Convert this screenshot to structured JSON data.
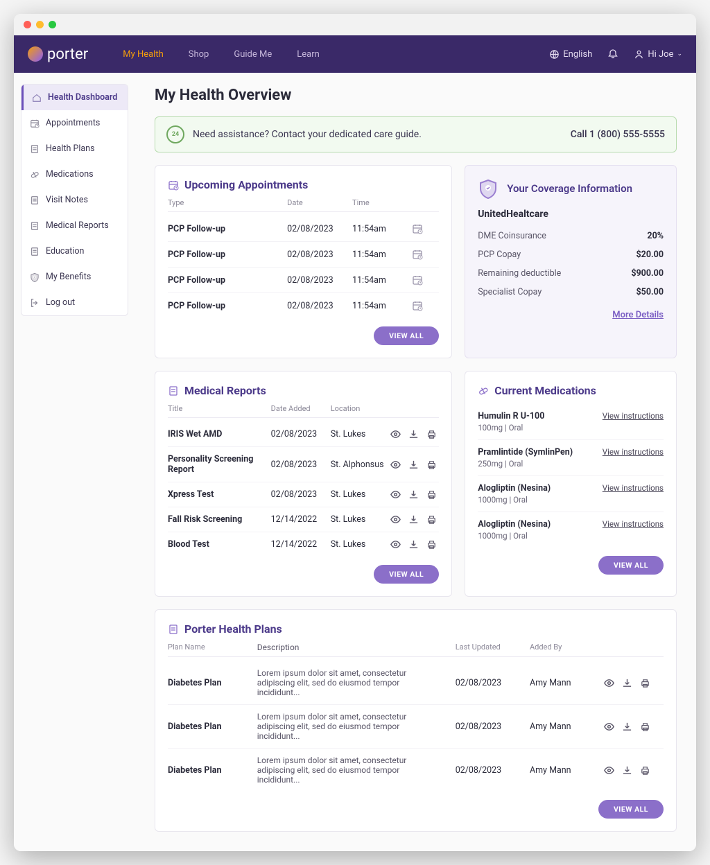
{
  "brand": "porter",
  "nav": {
    "items": [
      "My Health",
      "Shop",
      "Guide Me",
      "Learn"
    ],
    "active": 0
  },
  "topbar": {
    "lang": "English",
    "user": "Hi Joe"
  },
  "sidebar": {
    "items": [
      {
        "label": "Health Dashboard",
        "active": true
      },
      {
        "label": "Appointments"
      },
      {
        "label": "Health Plans"
      },
      {
        "label": "Medications"
      },
      {
        "label": "Visit Notes"
      },
      {
        "label": "Medical Reports"
      },
      {
        "label": "Education"
      },
      {
        "label": "My Benefits"
      },
      {
        "label": "Log out"
      }
    ]
  },
  "page_title": "My Health Overview",
  "banner": {
    "text": "Need assistance? Contact your dedicated care guide.",
    "call": "Call 1 (800) 555-5555"
  },
  "appointments": {
    "title": "Upcoming Appointments",
    "headers": {
      "type": "Type",
      "date": "Date",
      "time": "Time"
    },
    "rows": [
      {
        "type": "PCP Follow-up",
        "date": "02/08/2023",
        "time": "11:54am"
      },
      {
        "type": "PCP Follow-up",
        "date": "02/08/2023",
        "time": "11:54am"
      },
      {
        "type": "PCP Follow-up",
        "date": "02/08/2023",
        "time": "11:54am"
      },
      {
        "type": "PCP Follow-up",
        "date": "02/08/2023",
        "time": "11:54am"
      }
    ],
    "view_all": "VIEW ALL"
  },
  "coverage": {
    "title": "Your Coverage Information",
    "provider": "UnitedHealtcare",
    "rows": [
      {
        "label": "DME Coinsurance",
        "value": "20%"
      },
      {
        "label": "PCP Copay",
        "value": "$20.00"
      },
      {
        "label": "Remaining deductible",
        "value": "$900.00"
      },
      {
        "label": "Specialist Copay",
        "value": "$50.00"
      }
    ],
    "more": "More Details"
  },
  "reports": {
    "title": "Medical Reports",
    "headers": {
      "title": "Title",
      "date": "Date Added",
      "loc": "Location"
    },
    "rows": [
      {
        "title": "IRIS Wet AMD",
        "date": "02/08/2023",
        "loc": "St. Lukes"
      },
      {
        "title": "Personality Screening Report",
        "date": "02/08/2023",
        "loc": "St. Alphonsus"
      },
      {
        "title": "Xpress Test",
        "date": "02/08/2023",
        "loc": "St. Lukes"
      },
      {
        "title": "Fall Risk Screening",
        "date": "12/14/2022",
        "loc": "St. Lukes"
      },
      {
        "title": "Blood Test",
        "date": "12/14/2022",
        "loc": "St. Lukes"
      }
    ],
    "view_all": "VIEW ALL"
  },
  "medications": {
    "title": "Current Medications",
    "instructions_label": "View instructions",
    "rows": [
      {
        "name": "Humulin R U-100",
        "dose": "100mg | Oral"
      },
      {
        "name": "Pramlintide (SymlinPen)",
        "dose": "250mg | Oral"
      },
      {
        "name": "Alogliptin (Nesina)",
        "dose": "1000mg | Oral"
      },
      {
        "name": "Alogliptin (Nesina)",
        "dose": "1000mg | Oral"
      }
    ],
    "view_all": "VIEW ALL"
  },
  "plans": {
    "title": "Porter Health Plans",
    "headers": {
      "name": "Plan Name",
      "desc": "Description",
      "updated": "Last Updated",
      "by": "Added By"
    },
    "rows": [
      {
        "name": "Diabetes Plan",
        "desc": "Lorem ipsum dolor sit amet, consectetur adipiscing elit, sed do eiusmod tempor incididunt...",
        "updated": "02/08/2023",
        "by": "Amy Mann"
      },
      {
        "name": "Diabetes Plan",
        "desc": "Lorem ipsum dolor sit amet, consectetur adipiscing elit, sed do eiusmod tempor incididunt...",
        "updated": "02/08/2023",
        "by": "Amy Mann"
      },
      {
        "name": "Diabetes Plan",
        "desc": "Lorem ipsum dolor sit amet, consectetur adipiscing elit, sed do eiusmod tempor incididunt...",
        "updated": "02/08/2023",
        "by": "Amy Mann"
      }
    ],
    "view_all": "VIEW ALL"
  }
}
